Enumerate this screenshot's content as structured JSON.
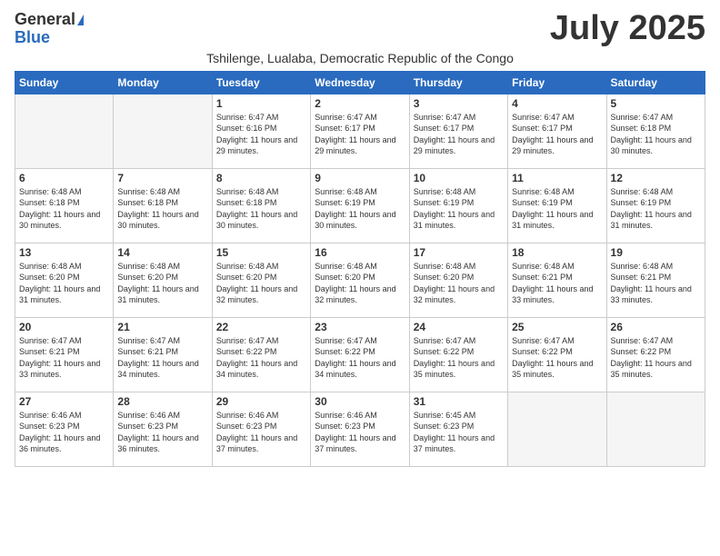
{
  "logo": {
    "general": "General",
    "blue": "Blue"
  },
  "header": {
    "month": "July 2025",
    "location": "Tshilenge, Lualaba, Democratic Republic of the Congo"
  },
  "days_of_week": [
    "Sunday",
    "Monday",
    "Tuesday",
    "Wednesday",
    "Thursday",
    "Friday",
    "Saturday"
  ],
  "weeks": [
    [
      {
        "day": "",
        "info": ""
      },
      {
        "day": "",
        "info": ""
      },
      {
        "day": "1",
        "info": "Sunrise: 6:47 AM\nSunset: 6:16 PM\nDaylight: 11 hours and 29 minutes."
      },
      {
        "day": "2",
        "info": "Sunrise: 6:47 AM\nSunset: 6:17 PM\nDaylight: 11 hours and 29 minutes."
      },
      {
        "day": "3",
        "info": "Sunrise: 6:47 AM\nSunset: 6:17 PM\nDaylight: 11 hours and 29 minutes."
      },
      {
        "day": "4",
        "info": "Sunrise: 6:47 AM\nSunset: 6:17 PM\nDaylight: 11 hours and 29 minutes."
      },
      {
        "day": "5",
        "info": "Sunrise: 6:47 AM\nSunset: 6:18 PM\nDaylight: 11 hours and 30 minutes."
      }
    ],
    [
      {
        "day": "6",
        "info": "Sunrise: 6:48 AM\nSunset: 6:18 PM\nDaylight: 11 hours and 30 minutes."
      },
      {
        "day": "7",
        "info": "Sunrise: 6:48 AM\nSunset: 6:18 PM\nDaylight: 11 hours and 30 minutes."
      },
      {
        "day": "8",
        "info": "Sunrise: 6:48 AM\nSunset: 6:18 PM\nDaylight: 11 hours and 30 minutes."
      },
      {
        "day": "9",
        "info": "Sunrise: 6:48 AM\nSunset: 6:19 PM\nDaylight: 11 hours and 30 minutes."
      },
      {
        "day": "10",
        "info": "Sunrise: 6:48 AM\nSunset: 6:19 PM\nDaylight: 11 hours and 31 minutes."
      },
      {
        "day": "11",
        "info": "Sunrise: 6:48 AM\nSunset: 6:19 PM\nDaylight: 11 hours and 31 minutes."
      },
      {
        "day": "12",
        "info": "Sunrise: 6:48 AM\nSunset: 6:19 PM\nDaylight: 11 hours and 31 minutes."
      }
    ],
    [
      {
        "day": "13",
        "info": "Sunrise: 6:48 AM\nSunset: 6:20 PM\nDaylight: 11 hours and 31 minutes."
      },
      {
        "day": "14",
        "info": "Sunrise: 6:48 AM\nSunset: 6:20 PM\nDaylight: 11 hours and 31 minutes."
      },
      {
        "day": "15",
        "info": "Sunrise: 6:48 AM\nSunset: 6:20 PM\nDaylight: 11 hours and 32 minutes."
      },
      {
        "day": "16",
        "info": "Sunrise: 6:48 AM\nSunset: 6:20 PM\nDaylight: 11 hours and 32 minutes."
      },
      {
        "day": "17",
        "info": "Sunrise: 6:48 AM\nSunset: 6:20 PM\nDaylight: 11 hours and 32 minutes."
      },
      {
        "day": "18",
        "info": "Sunrise: 6:48 AM\nSunset: 6:21 PM\nDaylight: 11 hours and 33 minutes."
      },
      {
        "day": "19",
        "info": "Sunrise: 6:48 AM\nSunset: 6:21 PM\nDaylight: 11 hours and 33 minutes."
      }
    ],
    [
      {
        "day": "20",
        "info": "Sunrise: 6:47 AM\nSunset: 6:21 PM\nDaylight: 11 hours and 33 minutes."
      },
      {
        "day": "21",
        "info": "Sunrise: 6:47 AM\nSunset: 6:21 PM\nDaylight: 11 hours and 34 minutes."
      },
      {
        "day": "22",
        "info": "Sunrise: 6:47 AM\nSunset: 6:22 PM\nDaylight: 11 hours and 34 minutes."
      },
      {
        "day": "23",
        "info": "Sunrise: 6:47 AM\nSunset: 6:22 PM\nDaylight: 11 hours and 34 minutes."
      },
      {
        "day": "24",
        "info": "Sunrise: 6:47 AM\nSunset: 6:22 PM\nDaylight: 11 hours and 35 minutes."
      },
      {
        "day": "25",
        "info": "Sunrise: 6:47 AM\nSunset: 6:22 PM\nDaylight: 11 hours and 35 minutes."
      },
      {
        "day": "26",
        "info": "Sunrise: 6:47 AM\nSunset: 6:22 PM\nDaylight: 11 hours and 35 minutes."
      }
    ],
    [
      {
        "day": "27",
        "info": "Sunrise: 6:46 AM\nSunset: 6:23 PM\nDaylight: 11 hours and 36 minutes."
      },
      {
        "day": "28",
        "info": "Sunrise: 6:46 AM\nSunset: 6:23 PM\nDaylight: 11 hours and 36 minutes."
      },
      {
        "day": "29",
        "info": "Sunrise: 6:46 AM\nSunset: 6:23 PM\nDaylight: 11 hours and 37 minutes."
      },
      {
        "day": "30",
        "info": "Sunrise: 6:46 AM\nSunset: 6:23 PM\nDaylight: 11 hours and 37 minutes."
      },
      {
        "day": "31",
        "info": "Sunrise: 6:45 AM\nSunset: 6:23 PM\nDaylight: 11 hours and 37 minutes."
      },
      {
        "day": "",
        "info": ""
      },
      {
        "day": "",
        "info": ""
      }
    ]
  ]
}
